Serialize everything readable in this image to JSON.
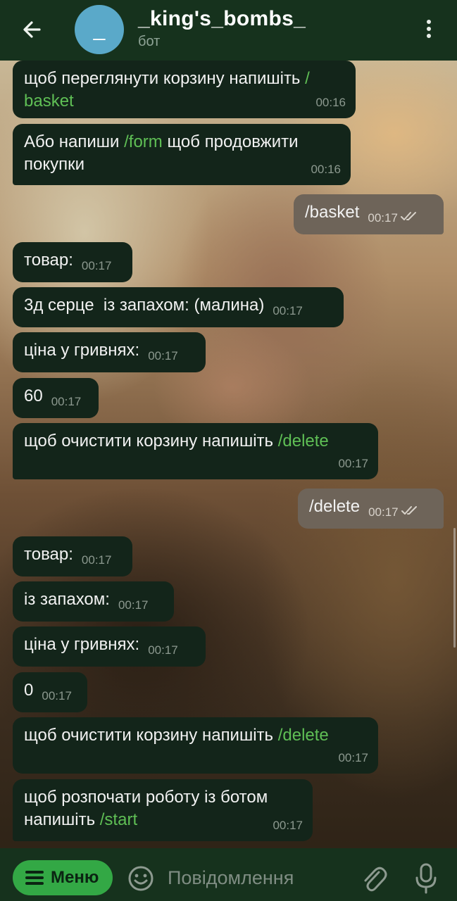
{
  "header": {
    "avatar_letter": "_",
    "title": "_king's_bombs_",
    "subtitle": "бот"
  },
  "messages": [
    {
      "dir": "in",
      "parts": [
        {
          "t": "щоб переглянути корзину напишіть "
        },
        {
          "t": "/\nbasket",
          "cmd": true
        }
      ],
      "time": "00:16"
    },
    {
      "dir": "in",
      "parts": [
        {
          "t": "Або напиши "
        },
        {
          "t": "/form",
          "cmd": true
        },
        {
          "t": " щоб продовжити\nпокупки"
        }
      ],
      "time": "00:16"
    },
    {
      "dir": "out",
      "parts": [
        {
          "t": "/basket"
        }
      ],
      "time": "00:17",
      "read": true
    },
    {
      "dir": "in",
      "parts": [
        {
          "t": "товар:"
        }
      ],
      "time": "00:17"
    },
    {
      "dir": "in",
      "parts": [
        {
          "t": "3д серце  із запахом: (малина)"
        }
      ],
      "time": "00:17"
    },
    {
      "dir": "in",
      "parts": [
        {
          "t": "ціна у гривнях:"
        }
      ],
      "time": "00:17"
    },
    {
      "dir": "in",
      "parts": [
        {
          "t": "60"
        }
      ],
      "time": "00:17"
    },
    {
      "dir": "in",
      "parts": [
        {
          "t": "щоб очистити корзину напишіть "
        },
        {
          "t": "/delete",
          "cmd": true
        }
      ],
      "time": "00:17"
    },
    {
      "dir": "out",
      "parts": [
        {
          "t": "/delete"
        }
      ],
      "time": "00:17",
      "read": true
    },
    {
      "dir": "in",
      "parts": [
        {
          "t": "товар:"
        }
      ],
      "time": "00:17"
    },
    {
      "dir": "in",
      "parts": [
        {
          "t": "із запахом:"
        }
      ],
      "time": "00:17"
    },
    {
      "dir": "in",
      "parts": [
        {
          "t": "ціна у гривнях:"
        }
      ],
      "time": "00:17"
    },
    {
      "dir": "in",
      "parts": [
        {
          "t": "0"
        }
      ],
      "time": "00:17"
    },
    {
      "dir": "in",
      "parts": [
        {
          "t": "щоб очистити корзину напишіть "
        },
        {
          "t": "/delete",
          "cmd": true
        }
      ],
      "time": "00:17"
    },
    {
      "dir": "in",
      "parts": [
        {
          "t": "щоб розпочати роботу із ботом\nнапишіть "
        },
        {
          "t": "/start",
          "cmd": true
        }
      ],
      "time": "00:17"
    }
  ],
  "composer": {
    "menu_label": "Меню",
    "placeholder": "Повідомлення"
  },
  "icons": {
    "back": "arrow-left-icon",
    "more": "more-vertical-icon",
    "emoji": "emoji-smile-icon",
    "attach": "paperclip-icon",
    "mic": "microphone-icon",
    "read": "double-check-icon"
  },
  "colors": {
    "header": "#16321d",
    "incoming_bubble": "#13251a",
    "outgoing_bubble": "#6e6459",
    "command_link": "#5fbf55",
    "menu_button": "#33a845"
  }
}
